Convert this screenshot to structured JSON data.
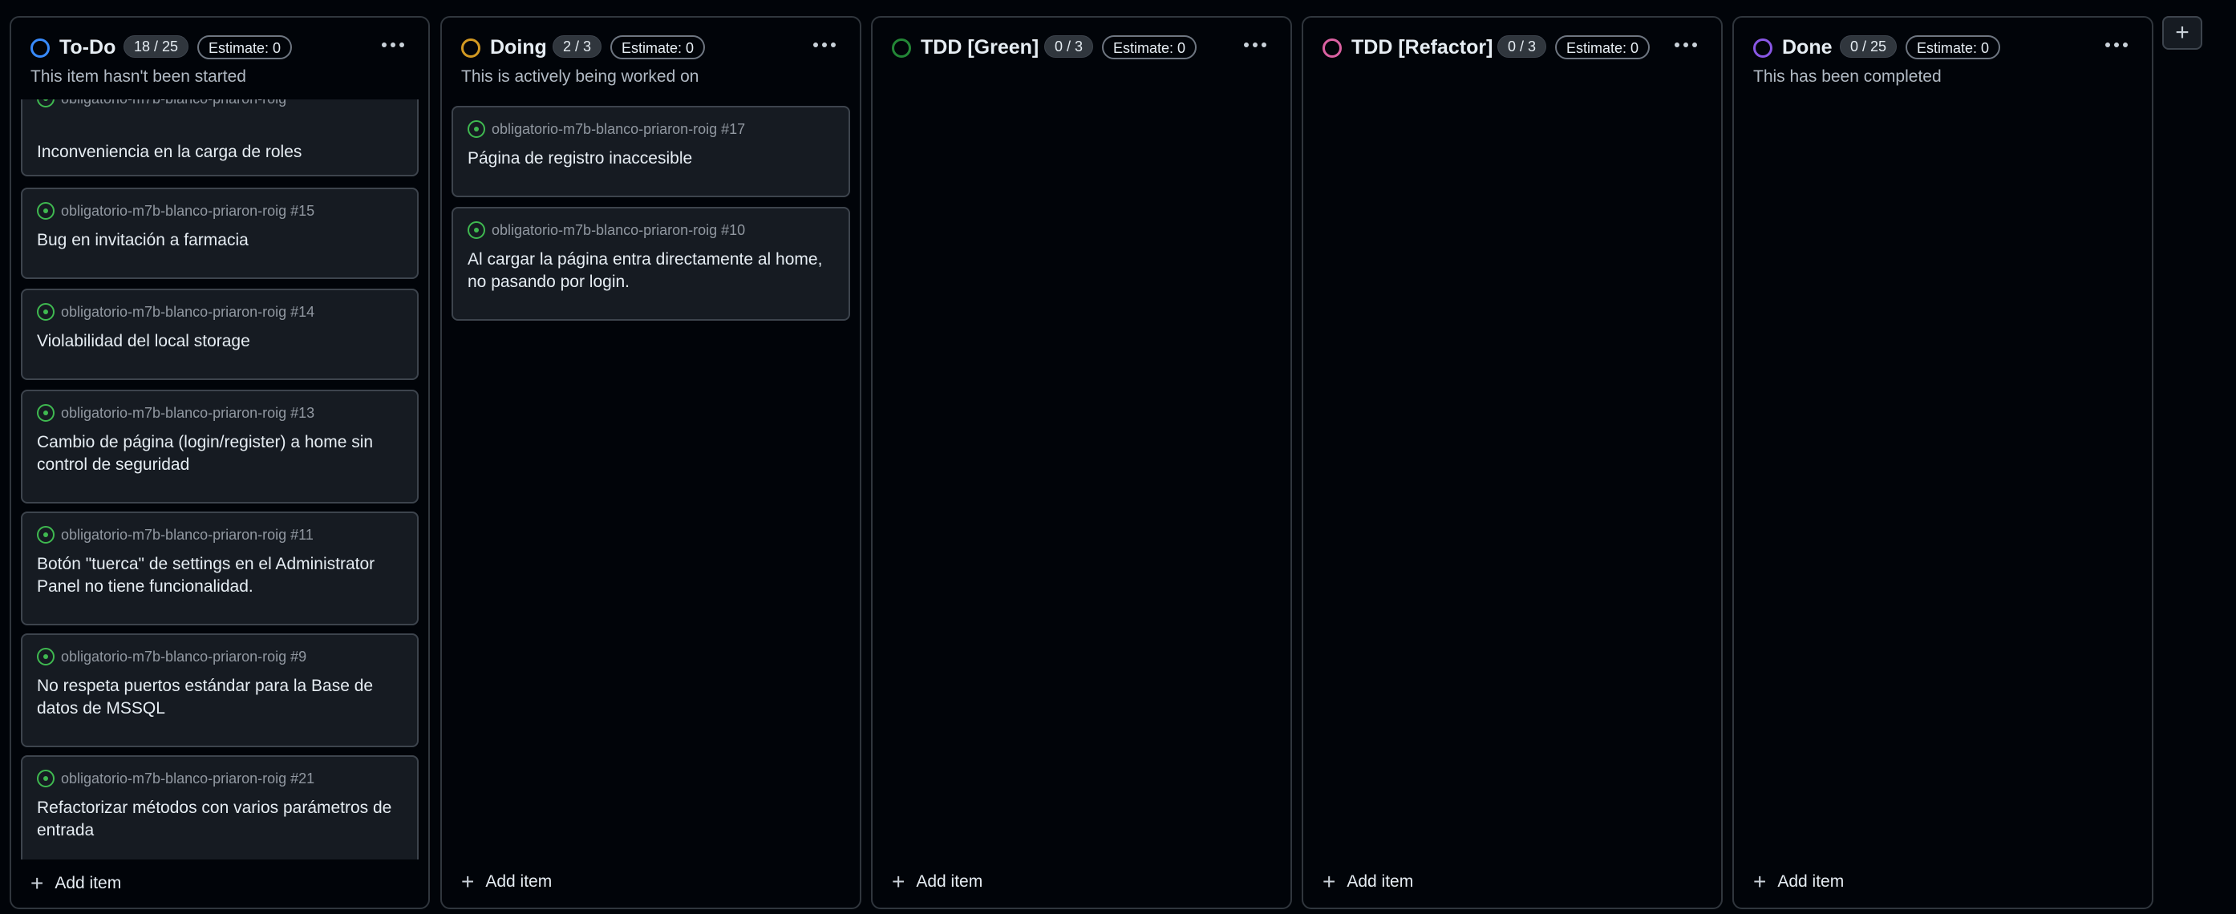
{
  "columns": [
    {
      "name": "To-Do",
      "count": "18 / 25",
      "estimate": "Estimate: 0",
      "description": "This item hasn't been started",
      "dot_color": "#388bfd",
      "cards": [
        {
          "repo": "obligatorio-m7b-blanco-priaron-roig",
          "title": "Inconveniencia en la carga de roles"
        },
        {
          "repo": "obligatorio-m7b-blanco-priaron-roig #15",
          "title": "Bug en invitación a farmacia"
        },
        {
          "repo": "obligatorio-m7b-blanco-priaron-roig #14",
          "title": "Violabilidad del local storage"
        },
        {
          "repo": "obligatorio-m7b-blanco-priaron-roig #13",
          "title": "Cambio de página (login/register) a home sin control de seguridad"
        },
        {
          "repo": "obligatorio-m7b-blanco-priaron-roig #11",
          "title": "Botón \"tuerca\" de settings en el Administrator Panel no tiene funcionalidad."
        },
        {
          "repo": "obligatorio-m7b-blanco-priaron-roig #9",
          "title": "No respeta puertos estándar para la Base de datos de MSSQL"
        },
        {
          "repo": "obligatorio-m7b-blanco-priaron-roig #21",
          "title": "Refactorizar métodos con varios parámetros de entrada"
        }
      ],
      "add_label": "Add item"
    },
    {
      "name": "Doing",
      "count": "2 / 3",
      "estimate": "Estimate: 0",
      "description": "This is actively being worked on",
      "dot_color": "#d29922",
      "cards": [
        {
          "repo": "obligatorio-m7b-blanco-priaron-roig #17",
          "title": "Página de registro inaccesible"
        },
        {
          "repo": "obligatorio-m7b-blanco-priaron-roig #10",
          "title": "Al cargar la página entra directamente al home, no pasando por login."
        }
      ],
      "add_label": "Add item"
    },
    {
      "name": "TDD [Green]",
      "count": "0 / 3",
      "estimate": "Estimate: 0",
      "description": "",
      "dot_color": "#3fb950",
      "cards": [],
      "add_label": "Add item"
    },
    {
      "name": "TDD [Refactor]",
      "count": "0 / 3",
      "estimate": "Estimate: 0",
      "description": "",
      "dot_color": "#db61a2",
      "cards": [],
      "add_label": "Add item"
    },
    {
      "name": "Done",
      "count": "0 / 25",
      "estimate": "Estimate: 0",
      "description": "This has been completed",
      "dot_color": "#a371f7",
      "cards": [],
      "add_label": "Add item"
    }
  ],
  "add_column_icon": "plus-icon"
}
